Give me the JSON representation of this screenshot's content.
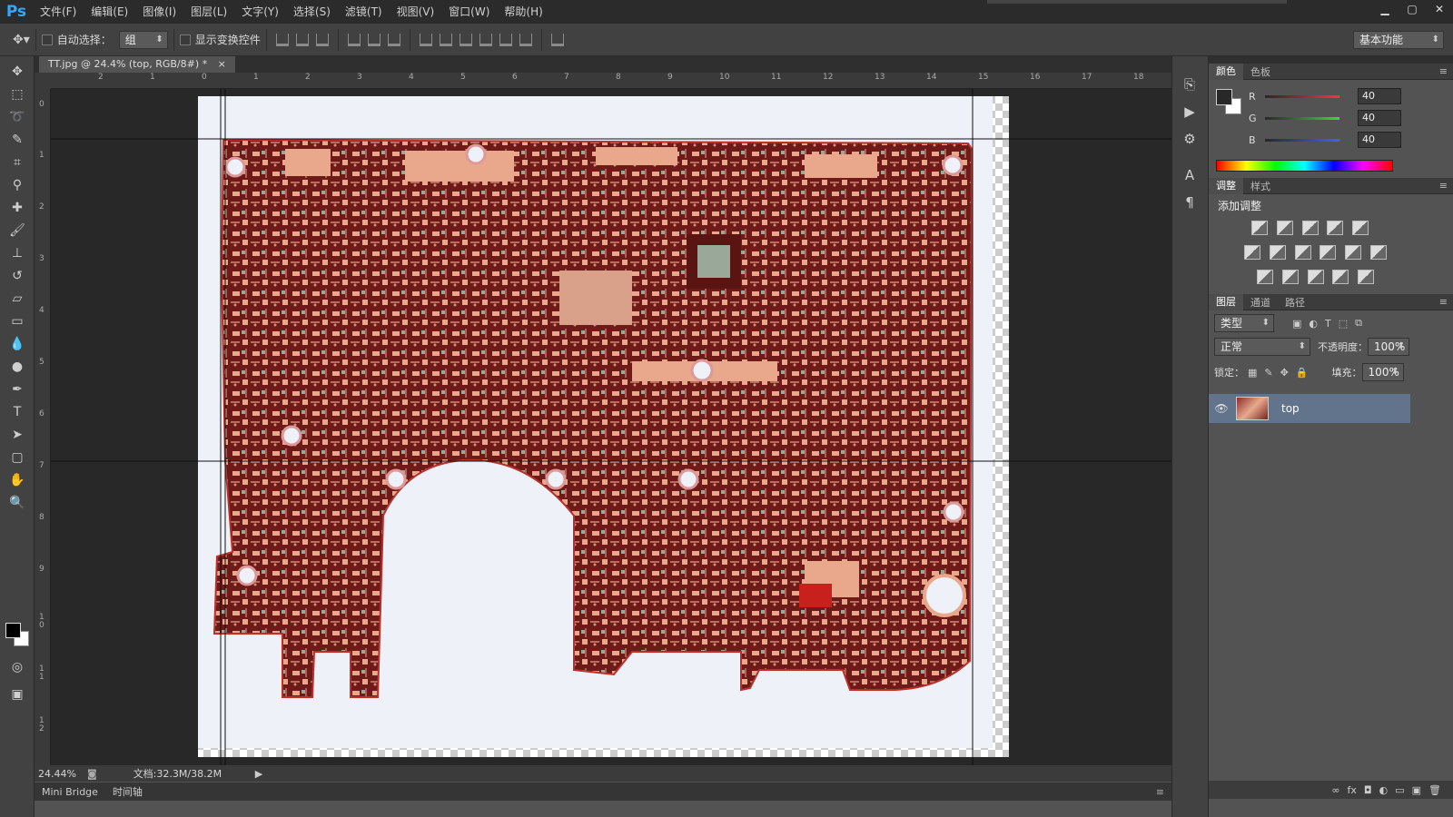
{
  "app": {
    "logo": "Ps"
  },
  "menu": [
    "文件(F)",
    "编辑(E)",
    "图像(I)",
    "图层(L)",
    "文字(Y)",
    "选择(S)",
    "滤镜(T)",
    "视图(V)",
    "窗口(W)",
    "帮助(H)"
  ],
  "window_controls": {
    "minimize": "▁",
    "restore": "▢",
    "close": "✕"
  },
  "options": {
    "auto_select_label": "自动选择：",
    "auto_select_value": "组",
    "show_transform_label": "显示变换控件",
    "workspace": "基本功能"
  },
  "document": {
    "tab_title": "TT.jpg @ 24.4% (top, RGB/8#) *",
    "tab_close": "×",
    "zoom": "24.44%",
    "doc_size": "文档:32.3M/38.2M"
  },
  "rulers": {
    "top": [
      "2",
      "1",
      "0",
      "1",
      "2",
      "3",
      "4",
      "5",
      "6",
      "7",
      "8",
      "9",
      "10",
      "11",
      "12",
      "13",
      "14",
      "15",
      "16",
      "17",
      "18"
    ],
    "left": [
      "0",
      "1",
      "2",
      "3",
      "4",
      "5",
      "6",
      "7",
      "8",
      "9",
      "1 0",
      "1 1",
      "1 2"
    ]
  },
  "bottom_tabs": [
    "Mini Bridge",
    "时间轴"
  ],
  "color_panel": {
    "tabs": [
      "颜色",
      "色板"
    ],
    "channels": [
      {
        "name": "R",
        "value": "40",
        "color": "#e33"
      },
      {
        "name": "G",
        "value": "40",
        "color": "#3c3"
      },
      {
        "name": "B",
        "value": "40",
        "color": "#36f"
      }
    ]
  },
  "adjust_panel": {
    "tabs": [
      "调整",
      "样式"
    ],
    "title": "添加调整"
  },
  "layers_panel": {
    "tabs": [
      "图层",
      "通道",
      "路径"
    ],
    "filter": "类型",
    "blend_mode": "正常",
    "opacity_label": "不透明度：",
    "opacity": "100%",
    "lock_label": "锁定：",
    "fill_label": "填充：",
    "fill": "100%",
    "layer_name": "top",
    "footer_icons": [
      "∞",
      "fx",
      "◘",
      "◐",
      "▭",
      "▣",
      "🗑"
    ]
  }
}
